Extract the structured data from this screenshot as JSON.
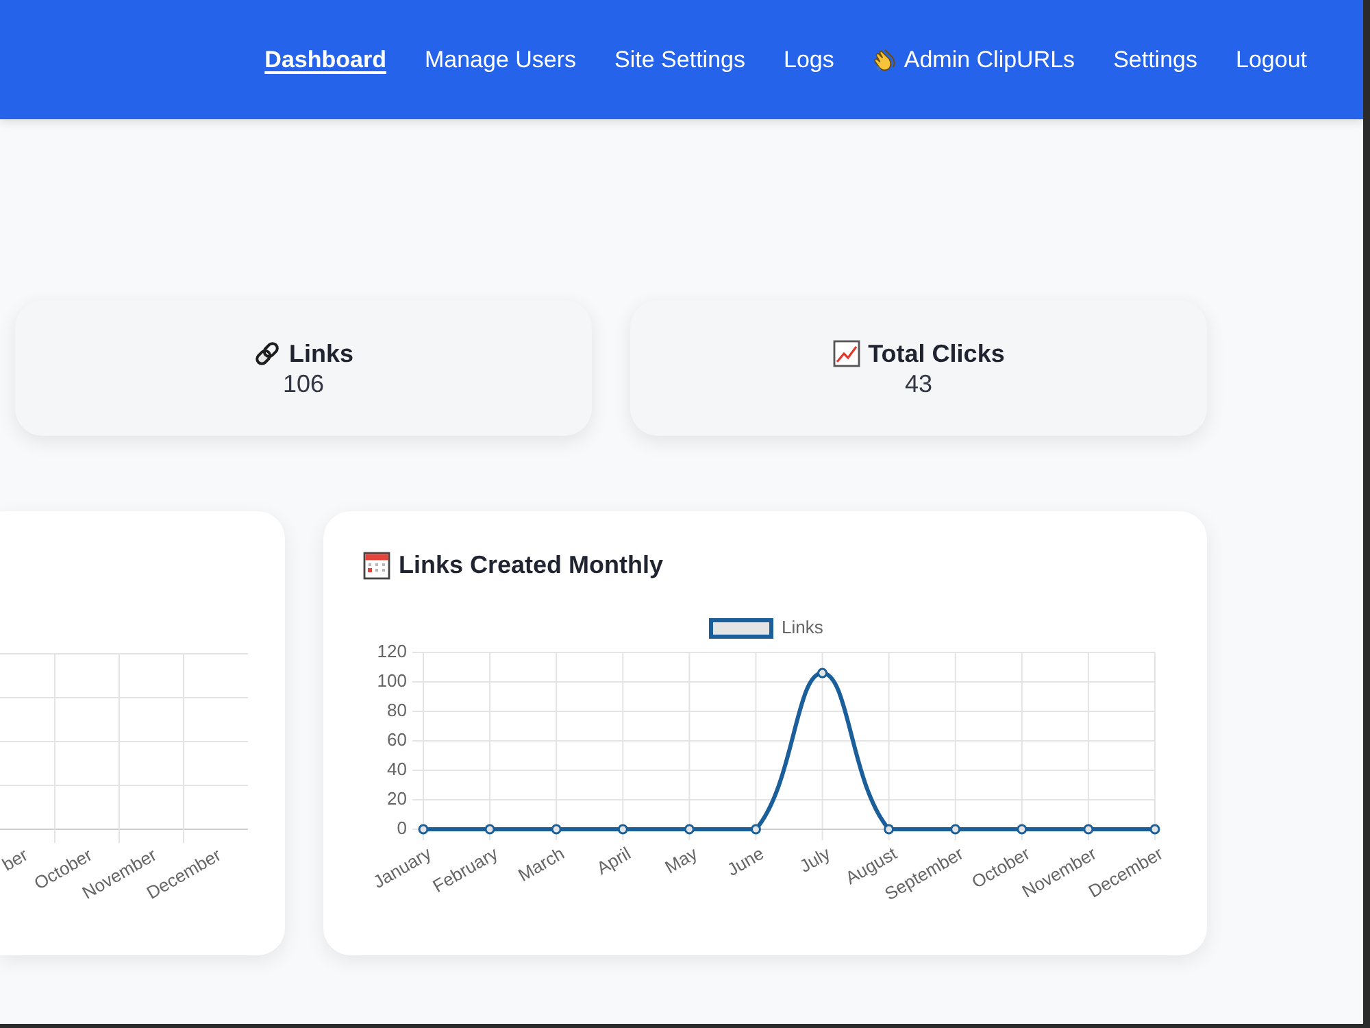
{
  "navbar": {
    "items": [
      {
        "label": "Dashboard",
        "selected": true,
        "kind": "plain"
      },
      {
        "label": "Manage Users",
        "selected": false,
        "kind": "plain"
      },
      {
        "label": "Site Settings",
        "selected": false,
        "kind": "plain"
      },
      {
        "label": "Logs",
        "selected": false,
        "kind": "plain"
      },
      {
        "label": "Admin ClipURLs",
        "selected": false,
        "kind": "admin"
      },
      {
        "label": "Settings",
        "selected": false,
        "kind": "plain"
      },
      {
        "label": "Logout",
        "selected": false,
        "kind": "plain"
      }
    ]
  },
  "stats": [
    {
      "kind": "links",
      "label": "Links",
      "value": "106"
    },
    {
      "kind": "clicks",
      "label": "Total Clicks",
      "value": "43"
    }
  ],
  "chart_card_left": {
    "x_labels": [
      "ber",
      "October",
      "November",
      "December"
    ]
  },
  "links_chart_card": {
    "title": "Links Created Monthly",
    "chart_data": {
      "type": "line",
      "categories": [
        "January",
        "February",
        "March",
        "April",
        "May",
        "June",
        "July",
        "August",
        "September",
        "October",
        "November",
        "December"
      ],
      "series": [
        {
          "name": "Links",
          "color": "#1a5e9a",
          "marker": true,
          "values": [
            0,
            0,
            0,
            0,
            0,
            0,
            106,
            0,
            0,
            0,
            0,
            0
          ]
        }
      ],
      "ylim": [
        0,
        120
      ],
      "yticks": [
        0,
        20,
        40,
        60,
        80,
        100,
        120
      ],
      "grid": true
    }
  }
}
